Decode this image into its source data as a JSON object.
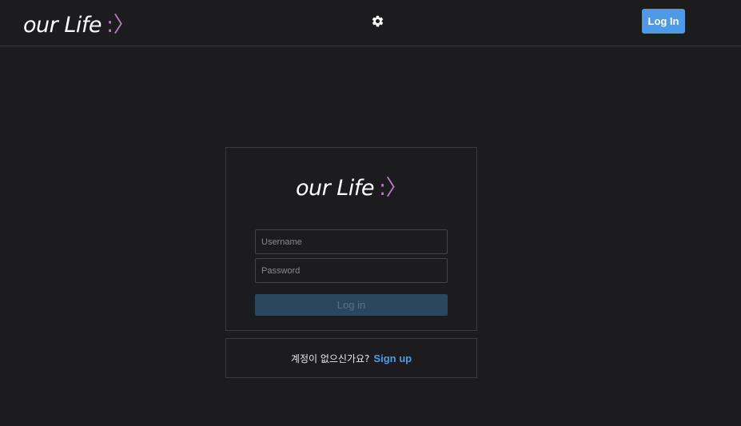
{
  "header": {
    "logo_text": "our Life",
    "logo_mark": ":〉",
    "settings_icon": "gear-icon",
    "login_button": "Log In"
  },
  "login_card": {
    "logo_text": "our Life",
    "logo_mark": ":〉",
    "username_placeholder": "Username",
    "password_placeholder": "Password",
    "submit_label": "Log in"
  },
  "signup": {
    "prompt": "계정이 없으신가요?",
    "link_label": "Sign up"
  },
  "colors": {
    "background": "#1c1c1e",
    "accent": "#4d9be6",
    "logo_mark": "#b57bbf",
    "border": "#3a3a3c",
    "submit_disabled": "#2b4760"
  }
}
